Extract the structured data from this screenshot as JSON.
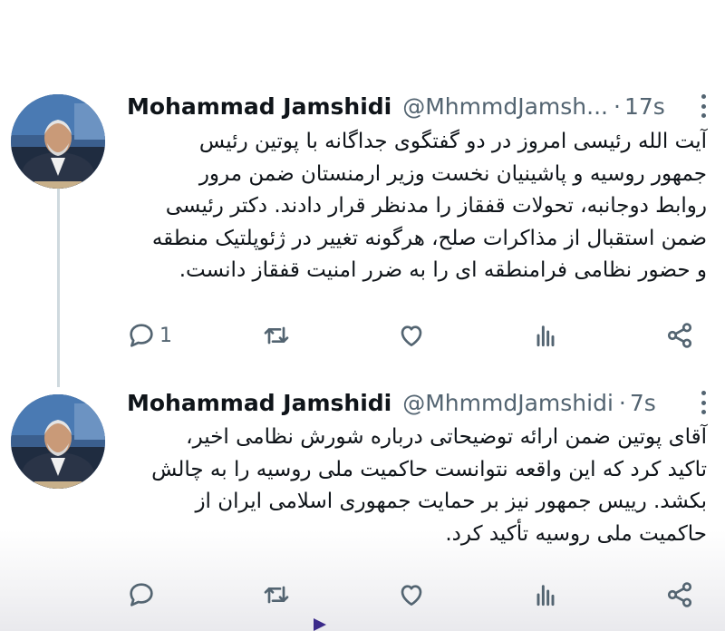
{
  "tweets": [
    {
      "name": "Mohammad Jamshidi",
      "handle": "@MhmmdJamsh...",
      "separator": "·",
      "time": "17s",
      "lines": [
        "آیت الله رئیسی امروز در دو گفتگوی جداگانه با پوتین رئیس",
        "جمهور روسیه و پاشینیان نخست وزیر ارمنستان  ضمن مرور",
        "روابط دوجانبه، تحولات قفقاز را مدنظر قرار دادند. دکتر رئیسی",
        "ضمن استقبال از مذاکرات صلح، هرگونه تغییر در ژئوپلتیک منطقه",
        "و حضور نظامی فرامنطقه ای را به ضرر امنیت قفقاز دانست."
      ],
      "reply_count": "1"
    },
    {
      "name": "Mohammad Jamshidi",
      "handle": "@MhmmdJamshidi",
      "separator": "·",
      "time": "7s",
      "lines": [
        "آقای پوتین ضمن ارائه توضیحاتی درباره شورش نظامی اخیر،",
        "تاکید کرد که این واقعه نتوانست حاکمیت ملی روسیه را به چالش",
        "بکشد. رییس جمهور نیز بر حمایت جمهوری اسلامی ایران از",
        "حاکمیت ملی روسیه تأکید کرد."
      ],
      "reply_count": ""
    }
  ],
  "icons": [
    "reply-icon",
    "retweet-icon",
    "like-icon",
    "views-icon",
    "share-icon",
    "more-options-icon"
  ],
  "colors": {
    "text": "#0f1419",
    "secondary": "#536471",
    "thread_line": "#cfd9de"
  }
}
